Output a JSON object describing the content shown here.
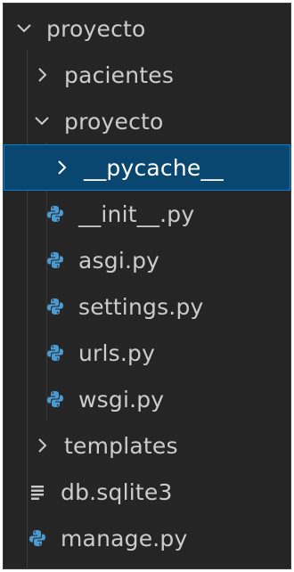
{
  "explorer": {
    "root": {
      "label": "proyecto",
      "icon": "chevron-down-icon"
    },
    "items": [
      {
        "label": "pacientes",
        "icon": "chevron-right-icon"
      },
      {
        "label": "proyecto",
        "icon": "chevron-down-icon"
      },
      {
        "label": "__pycache__",
        "icon": "chevron-right-icon"
      },
      {
        "label": "__init__.py",
        "icon": "python-icon"
      },
      {
        "label": "asgi.py",
        "icon": "python-icon"
      },
      {
        "label": "settings.py",
        "icon": "python-icon"
      },
      {
        "label": "urls.py",
        "icon": "python-icon"
      },
      {
        "label": "wsgi.py",
        "icon": "python-icon"
      },
      {
        "label": "templates",
        "icon": "chevron-right-icon"
      },
      {
        "label": "db.sqlite3",
        "icon": "database-file-icon"
      },
      {
        "label": "manage.py",
        "icon": "python-icon"
      }
    ]
  },
  "colors": {
    "background": "#252526",
    "text": "#cccccc",
    "selection": "#094771",
    "selection_border": "#007fd4",
    "python_icon": "#4b9cd3"
  }
}
